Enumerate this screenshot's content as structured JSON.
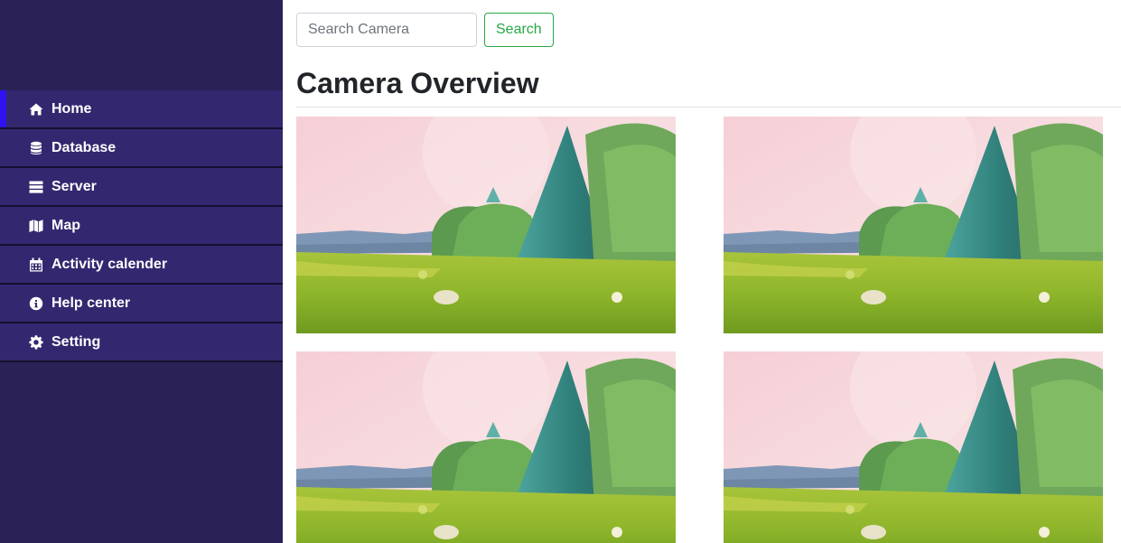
{
  "sidebar": {
    "items": [
      {
        "label": "Home",
        "icon": "home-icon",
        "active": true
      },
      {
        "label": "Database",
        "icon": "database-icon",
        "active": false
      },
      {
        "label": "Server",
        "icon": "server-icon",
        "active": false
      },
      {
        "label": "Map",
        "icon": "map-icon",
        "active": false
      },
      {
        "label": "Activity calender",
        "icon": "calendar-icon",
        "active": false
      },
      {
        "label": "Help center",
        "icon": "info-icon",
        "active": false
      },
      {
        "label": "Setting",
        "icon": "gear-icon",
        "active": false
      }
    ],
    "colors": {
      "background": "#2a2157",
      "item": "#33286f",
      "active_bar": "#2e13f0"
    }
  },
  "search": {
    "placeholder": "Search Camera",
    "value": "",
    "button_label": "Search",
    "button_color": "#28a745"
  },
  "main": {
    "title": "Camera Overview",
    "cameras": [
      {
        "feed": "camera-feed-1"
      },
      {
        "feed": "camera-feed-2"
      },
      {
        "feed": "camera-feed-3"
      },
      {
        "feed": "camera-feed-4"
      }
    ]
  }
}
